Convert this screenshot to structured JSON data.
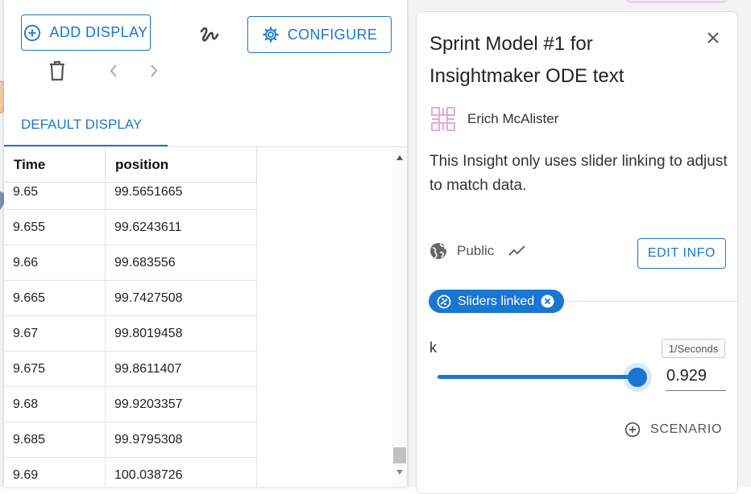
{
  "toolbar": {
    "add_display_label": "ADD DISPLAY",
    "configure_label": "CONFIGURE"
  },
  "tabs": [
    {
      "label": "DEFAULT DISPLAY",
      "active": true
    }
  ],
  "table": {
    "columns": [
      "Time",
      "position"
    ],
    "rows": [
      [
        "9.65",
        "99.5651665"
      ],
      [
        "9.655",
        "99.6243611"
      ],
      [
        "9.66",
        "99.683556"
      ],
      [
        "9.665",
        "99.7427508"
      ],
      [
        "9.67",
        "99.8019458"
      ],
      [
        "9.675",
        "99.8611407"
      ],
      [
        "9.68",
        "99.9203357"
      ],
      [
        "9.685",
        "99.9795308"
      ],
      [
        "9.69",
        "100.038726"
      ]
    ]
  },
  "info": {
    "title": "Sprint Model #1 for Insightmaker ODE text",
    "author": "Erich McAlister",
    "description": "This Insight only uses slider linking to adjust to match data.",
    "visibility": "Public",
    "edit_label": "EDIT INFO",
    "chip_label": "Sliders linked",
    "slider": {
      "name": "k",
      "unit": "1/Seconds",
      "value": "0.929",
      "fraction": 0.96
    },
    "scenario_label": "SCENARIO"
  },
  "colors": {
    "accent": "#1976d2"
  }
}
